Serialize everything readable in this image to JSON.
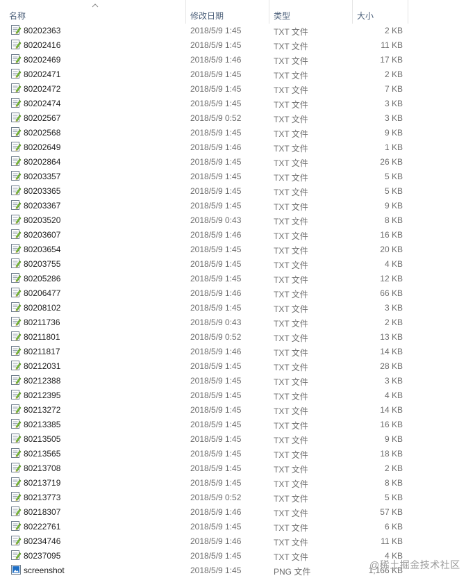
{
  "columns": {
    "name": "名称",
    "date": "修改日期",
    "type": "类型",
    "size": "大小"
  },
  "files": [
    {
      "name": "80202363",
      "date": "2018/5/9 1:45",
      "type": "TXT 文件",
      "size": "2 KB",
      "icon": "text-file-icon"
    },
    {
      "name": "80202416",
      "date": "2018/5/9 1:45",
      "type": "TXT 文件",
      "size": "11 KB",
      "icon": "text-file-icon"
    },
    {
      "name": "80202469",
      "date": "2018/5/9 1:46",
      "type": "TXT 文件",
      "size": "17 KB",
      "icon": "text-file-icon"
    },
    {
      "name": "80202471",
      "date": "2018/5/9 1:45",
      "type": "TXT 文件",
      "size": "2 KB",
      "icon": "text-file-icon"
    },
    {
      "name": "80202472",
      "date": "2018/5/9 1:45",
      "type": "TXT 文件",
      "size": "7 KB",
      "icon": "text-file-icon"
    },
    {
      "name": "80202474",
      "date": "2018/5/9 1:45",
      "type": "TXT 文件",
      "size": "3 KB",
      "icon": "text-file-icon"
    },
    {
      "name": "80202567",
      "date": "2018/5/9 0:52",
      "type": "TXT 文件",
      "size": "3 KB",
      "icon": "text-file-icon"
    },
    {
      "name": "80202568",
      "date": "2018/5/9 1:45",
      "type": "TXT 文件",
      "size": "9 KB",
      "icon": "text-file-icon"
    },
    {
      "name": "80202649",
      "date": "2018/5/9 1:46",
      "type": "TXT 文件",
      "size": "1 KB",
      "icon": "text-file-icon"
    },
    {
      "name": "80202864",
      "date": "2018/5/9 1:45",
      "type": "TXT 文件",
      "size": "26 KB",
      "icon": "text-file-icon"
    },
    {
      "name": "80203357",
      "date": "2018/5/9 1:45",
      "type": "TXT 文件",
      "size": "5 KB",
      "icon": "text-file-icon"
    },
    {
      "name": "80203365",
      "date": "2018/5/9 1:45",
      "type": "TXT 文件",
      "size": "5 KB",
      "icon": "text-file-icon"
    },
    {
      "name": "80203367",
      "date": "2018/5/9 1:45",
      "type": "TXT 文件",
      "size": "9 KB",
      "icon": "text-file-icon"
    },
    {
      "name": "80203520",
      "date": "2018/5/9 0:43",
      "type": "TXT 文件",
      "size": "8 KB",
      "icon": "text-file-icon"
    },
    {
      "name": "80203607",
      "date": "2018/5/9 1:46",
      "type": "TXT 文件",
      "size": "16 KB",
      "icon": "text-file-icon"
    },
    {
      "name": "80203654",
      "date": "2018/5/9 1:45",
      "type": "TXT 文件",
      "size": "20 KB",
      "icon": "text-file-icon"
    },
    {
      "name": "80203755",
      "date": "2018/5/9 1:45",
      "type": "TXT 文件",
      "size": "4 KB",
      "icon": "text-file-icon"
    },
    {
      "name": "80205286",
      "date": "2018/5/9 1:45",
      "type": "TXT 文件",
      "size": "12 KB",
      "icon": "text-file-icon"
    },
    {
      "name": "80206477",
      "date": "2018/5/9 1:46",
      "type": "TXT 文件",
      "size": "66 KB",
      "icon": "text-file-icon"
    },
    {
      "name": "80208102",
      "date": "2018/5/9 1:45",
      "type": "TXT 文件",
      "size": "3 KB",
      "icon": "text-file-icon"
    },
    {
      "name": "80211736",
      "date": "2018/5/9 0:43",
      "type": "TXT 文件",
      "size": "2 KB",
      "icon": "text-file-icon"
    },
    {
      "name": "80211801",
      "date": "2018/5/9 0:52",
      "type": "TXT 文件",
      "size": "13 KB",
      "icon": "text-file-icon"
    },
    {
      "name": "80211817",
      "date": "2018/5/9 1:46",
      "type": "TXT 文件",
      "size": "14 KB",
      "icon": "text-file-icon"
    },
    {
      "name": "80212031",
      "date": "2018/5/9 1:45",
      "type": "TXT 文件",
      "size": "28 KB",
      "icon": "text-file-icon"
    },
    {
      "name": "80212388",
      "date": "2018/5/9 1:45",
      "type": "TXT 文件",
      "size": "3 KB",
      "icon": "text-file-icon"
    },
    {
      "name": "80212395",
      "date": "2018/5/9 1:45",
      "type": "TXT 文件",
      "size": "4 KB",
      "icon": "text-file-icon"
    },
    {
      "name": "80213272",
      "date": "2018/5/9 1:45",
      "type": "TXT 文件",
      "size": "14 KB",
      "icon": "text-file-icon"
    },
    {
      "name": "80213385",
      "date": "2018/5/9 1:45",
      "type": "TXT 文件",
      "size": "16 KB",
      "icon": "text-file-icon"
    },
    {
      "name": "80213505",
      "date": "2018/5/9 1:45",
      "type": "TXT 文件",
      "size": "9 KB",
      "icon": "text-file-icon"
    },
    {
      "name": "80213565",
      "date": "2018/5/9 1:45",
      "type": "TXT 文件",
      "size": "18 KB",
      "icon": "text-file-icon"
    },
    {
      "name": "80213708",
      "date": "2018/5/9 1:45",
      "type": "TXT 文件",
      "size": "2 KB",
      "icon": "text-file-icon"
    },
    {
      "name": "80213719",
      "date": "2018/5/9 1:45",
      "type": "TXT 文件",
      "size": "8 KB",
      "icon": "text-file-icon"
    },
    {
      "name": "80213773",
      "date": "2018/5/9 0:52",
      "type": "TXT 文件",
      "size": "5 KB",
      "icon": "text-file-icon"
    },
    {
      "name": "80218307",
      "date": "2018/5/9 1:46",
      "type": "TXT 文件",
      "size": "57 KB",
      "icon": "text-file-icon"
    },
    {
      "name": "80222761",
      "date": "2018/5/9 1:45",
      "type": "TXT 文件",
      "size": "6 KB",
      "icon": "text-file-icon"
    },
    {
      "name": "80234746",
      "date": "2018/5/9 1:46",
      "type": "TXT 文件",
      "size": "11 KB",
      "icon": "text-file-icon"
    },
    {
      "name": "80237095",
      "date": "2018/5/9 1:45",
      "type": "TXT 文件",
      "size": "4 KB",
      "icon": "text-file-icon"
    },
    {
      "name": "screenshot",
      "date": "2018/5/9 1:45",
      "type": "PNG 文件",
      "size": "1,166 KB",
      "icon": "image-file-icon"
    }
  ],
  "watermark": "@稀土掘金技术社区",
  "colors": {
    "header_text": "#4c607a",
    "file_name": "#1e1e1e",
    "secondary_text": "#6d6d6d",
    "column_divider": "#e5e5e5"
  }
}
